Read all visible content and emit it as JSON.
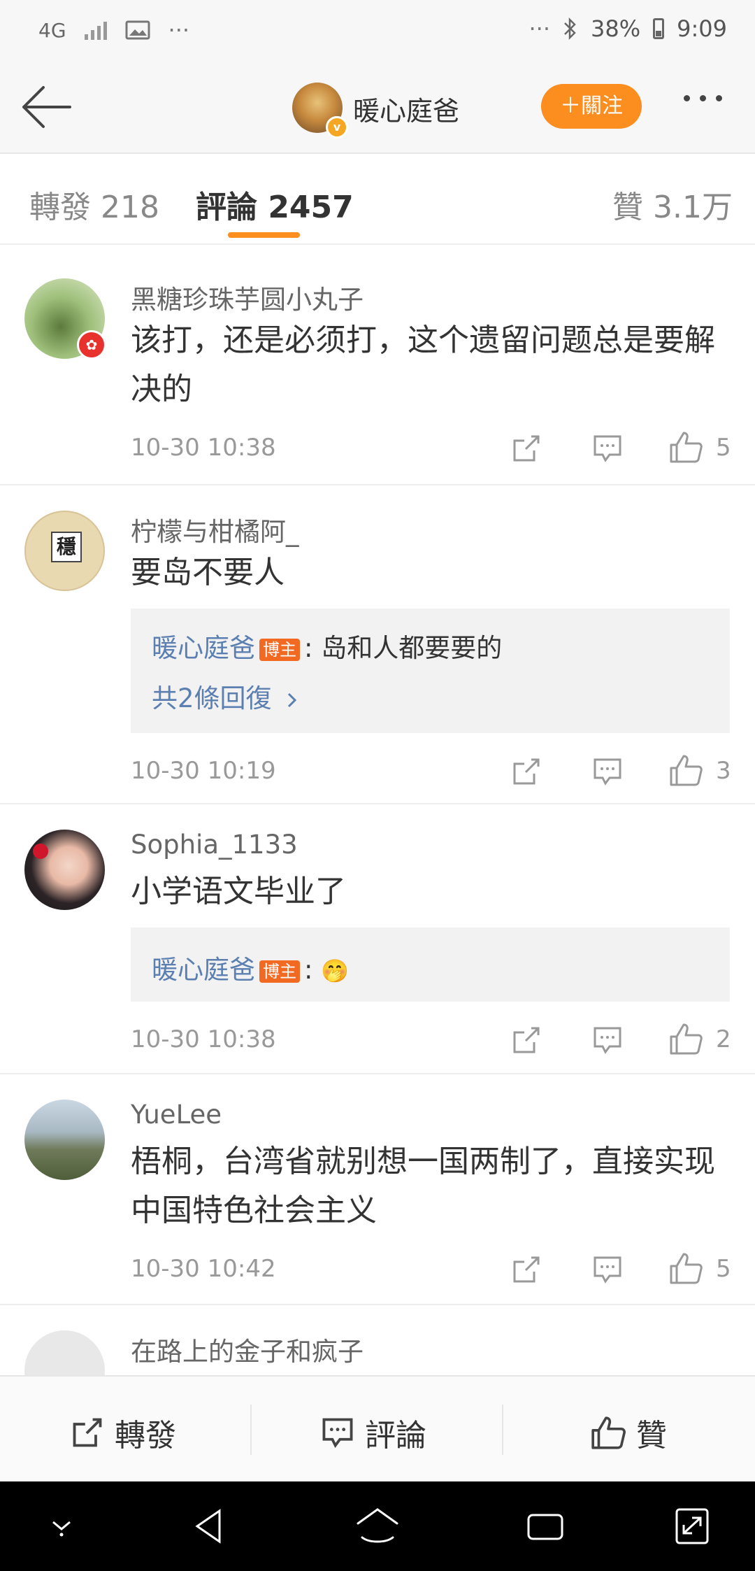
{
  "status_bar": {
    "network": "4G",
    "time": "9:09",
    "battery": "38%",
    "dots": "···"
  },
  "header": {
    "title": "暖心庭爸",
    "follow_label": "＋關注"
  },
  "tabs": [
    {
      "label": "轉發 218"
    },
    {
      "label": "評論 2457"
    },
    {
      "label": "贊 3.1万"
    }
  ],
  "comments": [
    {
      "name": "黑糖珍珠芋圆小丸子",
      "text": "该打，还是必须打，这个遗留问题总是要解决的",
      "time": "10-30 10:38",
      "likes": "5"
    },
    {
      "name": "柠檬与柑橘阿_",
      "text": "要岛不要人",
      "time": "10-30 10:19",
      "likes": "3",
      "reply": {
        "name": "暖心庭爸",
        "tag": "博主",
        "text": ": 岛和人都要要的",
        "more": "共2條回復"
      }
    },
    {
      "name": "Sophia_1133",
      "text": "小学语文毕业了",
      "time": "10-30 10:38",
      "likes": "2",
      "reply": {
        "name": "暖心庭爸",
        "tag": "博主",
        "text": ":",
        "emoji": "🤭"
      }
    },
    {
      "name": "YueLee",
      "text": "梧桐，台湾省就别想一国两制了，直接实现中国特色社会主义",
      "time": "10-30 10:42",
      "likes": "5"
    },
    {
      "name": "在路上的金子和疯子"
    }
  ],
  "bottom_bar": {
    "repost": "轉發",
    "comment": "評論",
    "like": "贊"
  },
  "colors": {
    "accent": "#fb8e1f",
    "link": "#5b7fb1",
    "tag": "#f26a22"
  }
}
